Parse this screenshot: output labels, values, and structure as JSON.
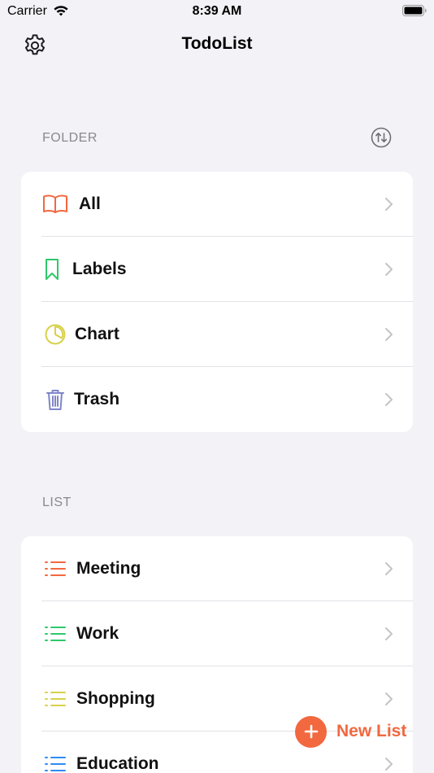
{
  "status_bar": {
    "carrier": "Carrier",
    "time": "8:39 AM"
  },
  "nav": {
    "title": "TodoList",
    "settings_icon": "gear-icon"
  },
  "folder_section": {
    "header": "FOLDER",
    "sort_icon": "sort-arrows-icon",
    "items": [
      {
        "label": "All",
        "icon": "book-icon",
        "color": "#f2683f"
      },
      {
        "label": "Labels",
        "icon": "bookmark-icon",
        "color": "#2fc86b"
      },
      {
        "label": "Chart",
        "icon": "pie-chart-icon",
        "color": "#d8d14a"
      },
      {
        "label": "Trash",
        "icon": "trash-icon",
        "color": "#7f86c9"
      }
    ]
  },
  "list_section": {
    "header": "LIST",
    "items": [
      {
        "label": "Meeting",
        "icon": "list-icon",
        "color": "#f2683f"
      },
      {
        "label": "Work",
        "icon": "list-icon",
        "color": "#2fc86b"
      },
      {
        "label": "Shopping",
        "icon": "list-icon",
        "color": "#d8d14a"
      },
      {
        "label": "Education",
        "icon": "list-icon",
        "color": "#2f8bf2"
      }
    ]
  },
  "new_list_button": {
    "label": "New List",
    "color": "#f2683f"
  },
  "chevron_color": "#c4c4c7"
}
